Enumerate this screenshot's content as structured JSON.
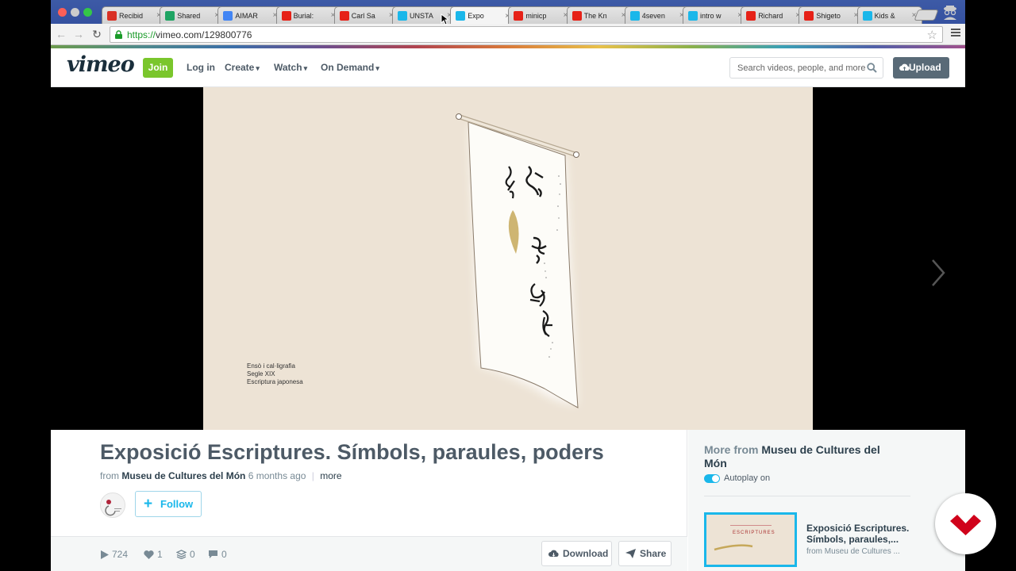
{
  "browser": {
    "tabs": [
      {
        "title": "Recibid",
        "favicon": "gmail-icon",
        "color": "#d93025"
      },
      {
        "title": "Shared",
        "favicon": "drive-icon",
        "color": "#1fa463"
      },
      {
        "title": "AIMAR",
        "favicon": "docs-icon",
        "color": "#4285f4"
      },
      {
        "title": "Burial: ",
        "favicon": "youtube-icon",
        "color": "#e62117"
      },
      {
        "title": "Carl Sa",
        "favicon": "youtube-icon",
        "color": "#e62117"
      },
      {
        "title": "UNSTA",
        "favicon": "pause-icon",
        "color": "#1ab7ea"
      },
      {
        "title": "Expo",
        "favicon": "pause-icon",
        "color": "#1ab7ea"
      },
      {
        "title": "minicp",
        "favicon": "youtube-icon",
        "color": "#e62117"
      },
      {
        "title": "The Kn",
        "favicon": "youtube-icon",
        "color": "#e62117"
      },
      {
        "title": "4seven",
        "favicon": "pause-icon",
        "color": "#1ab7ea"
      },
      {
        "title": "intro w",
        "favicon": "vimeo-icon",
        "color": "#1ab7ea"
      },
      {
        "title": "Richard",
        "favicon": "youtube-icon",
        "color": "#e62117"
      },
      {
        "title": "Shigeto",
        "favicon": "youtube-icon",
        "color": "#e62117"
      },
      {
        "title": "Kids & ",
        "favicon": "pause-icon",
        "color": "#1ab7ea"
      }
    ],
    "url_scheme": "https://",
    "url_rest": "vimeo.com/129800776"
  },
  "header": {
    "logo": "vimeo",
    "join": "Join",
    "login": "Log in",
    "create": "Create",
    "watch": "Watch",
    "on_demand": "On Demand",
    "search_placeholder": "Search videos, people, and more",
    "upload": "Upload"
  },
  "player": {
    "caption_line1": "Ensò i cal·ligrafia",
    "caption_line2": "Segle XIX",
    "caption_line3": "Escriptura japonesa"
  },
  "video": {
    "title": "Exposició Escriptures. Símbols, paraules, poders",
    "from": "from",
    "owner": "Museu de Cultures del Món",
    "age": "6 months ago",
    "more": "more",
    "follow": "Follow",
    "plays": "724",
    "likes": "1",
    "collections": "0",
    "comments": "0",
    "download": "Download",
    "share": "Share"
  },
  "sidebar": {
    "more_from_prefix": "More from",
    "owner": "Museu de Cultures del Món",
    "autoplay": "Autoplay on",
    "autoplay_enabled": true,
    "rec_title": "Exposició Escriptures. Símbols, paraules,...",
    "rec_owner": "from Museu de Cultures ...",
    "rec_thumb_title": "ESCRIPTURES"
  },
  "colors": {
    "vimeo_blue": "#1ab7ea",
    "join_green": "#7ac62c",
    "badge_red": "#d0021b"
  }
}
